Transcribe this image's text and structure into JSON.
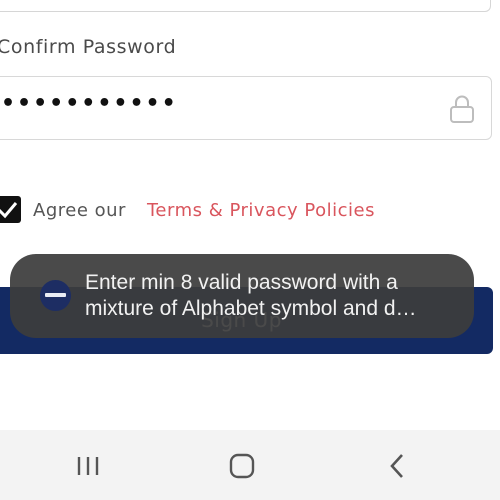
{
  "form": {
    "confirm_password_label": "Confirm Password",
    "confirm_password_value": "•••••••••••",
    "agree_text": "Agree our",
    "terms_link": "Terms & Privacy Policies",
    "agree_checked": true,
    "signup_button_label": "Sign Up"
  },
  "toast": {
    "message": "Enter min 8 valid password with a mixture of Alphabet symbol and d…",
    "app_icon": "app-logo-icon"
  },
  "nav_bar": {
    "recents_icon": "recent-apps-icon",
    "home_icon": "home-icon",
    "back_icon": "back-icon"
  },
  "colors": {
    "primary_button": "#132a63",
    "link": "#d9555d",
    "toast_bg": "#3c3c3c"
  }
}
